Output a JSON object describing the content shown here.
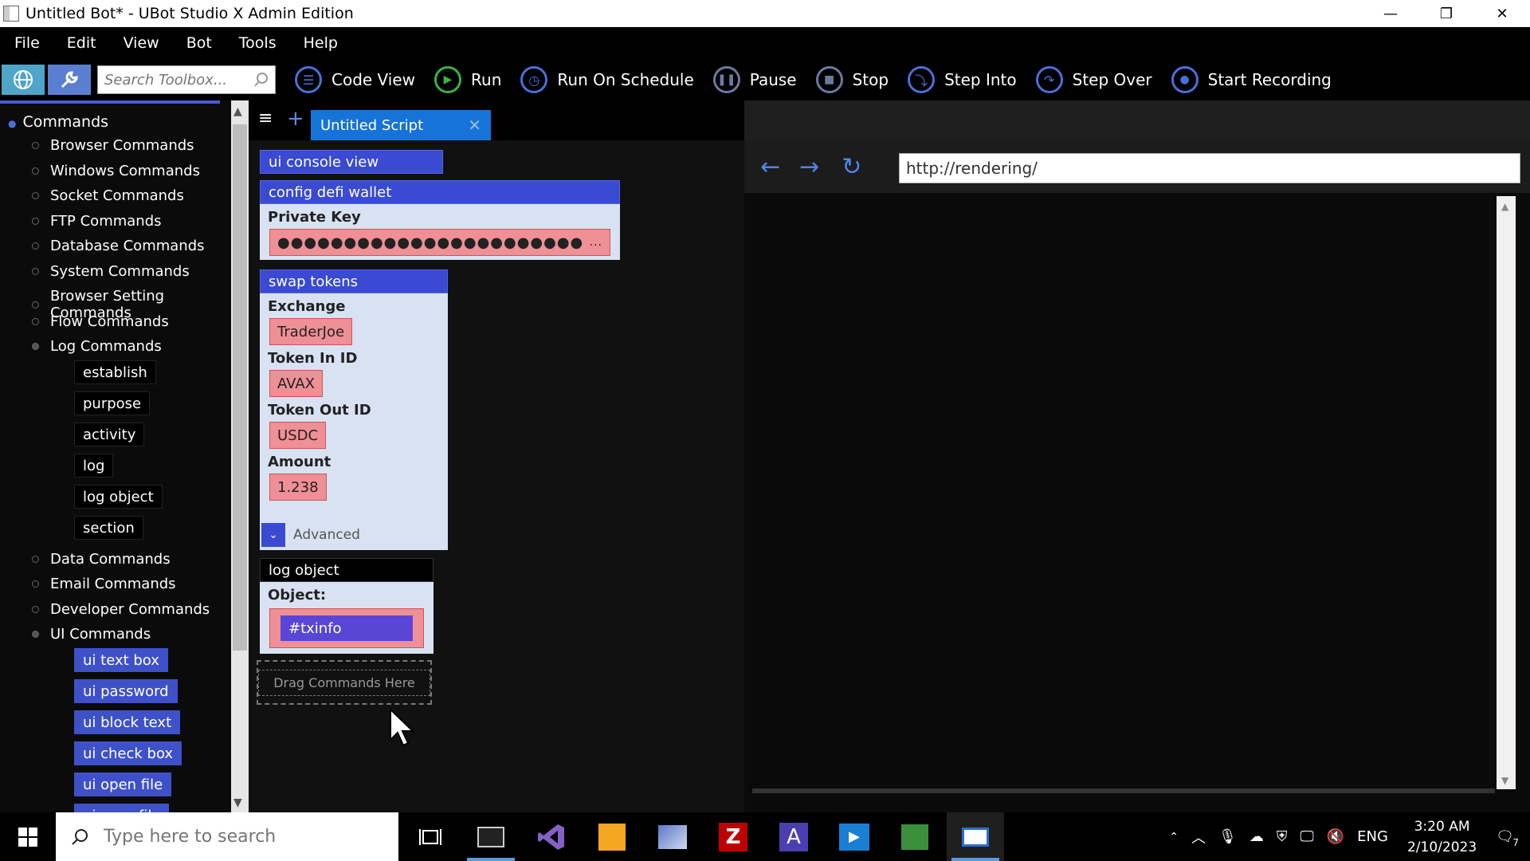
{
  "window": {
    "title": "Untitled Bot* - UBot Studio X Admin Edition",
    "controls": [
      "—",
      "❐",
      "✕"
    ]
  },
  "menu": [
    "File",
    "Edit",
    "View",
    "Bot",
    "Tools",
    "Help"
  ],
  "toolbar": {
    "search_placeholder": "Search Toolbox...",
    "buttons": [
      "Code View",
      "Run",
      "Run On Schedule",
      "Pause",
      "Stop",
      "Step Into",
      "Step Over",
      "Start Recording"
    ]
  },
  "sidebar": {
    "root": "Commands",
    "categories_top": [
      "Browser Commands",
      "Windows Commands",
      "Socket Commands",
      "FTP Commands",
      "Database Commands",
      "System Commands",
      "Browser Setting Commands",
      "Flow Commands",
      "Log Commands"
    ],
    "log_commands": [
      "establish",
      "purpose",
      "activity",
      "log",
      "log object",
      "section"
    ],
    "categories_mid": [
      "Data Commands",
      "Email Commands",
      "Developer Commands",
      "UI Commands"
    ],
    "ui_commands": [
      "ui text box",
      "ui password",
      "ui block text",
      "ui check box",
      "ui open file",
      "ui save file"
    ]
  },
  "editor": {
    "tab_label": "Untitled Script",
    "blocks": {
      "console": "ui console view",
      "config": {
        "title": "config defi wallet",
        "label": "Private Key",
        "value": "●●●●●●●●●●●●●●●●●●●●●●●",
        "more": "..."
      },
      "swap": {
        "title": "swap tokens",
        "exchange_label": "Exchange",
        "exchange": "TraderJoe",
        "in_label": "Token In ID",
        "in": "AVAX",
        "out_label": "Token Out ID",
        "out": "USDC",
        "amount_label": "Amount",
        "amount": "1.238",
        "advanced": "Advanced"
      },
      "log": {
        "title": "log object",
        "label": "Object:",
        "value": "#txinfo"
      }
    },
    "drop_hint": "Drag Commands Here"
  },
  "browser": {
    "url": "http://rendering/"
  },
  "taskbar": {
    "search_placeholder": "Type here to search",
    "lang": "ENG",
    "time": "3:20 AM",
    "date": "2/10/2023",
    "notif": "7"
  }
}
